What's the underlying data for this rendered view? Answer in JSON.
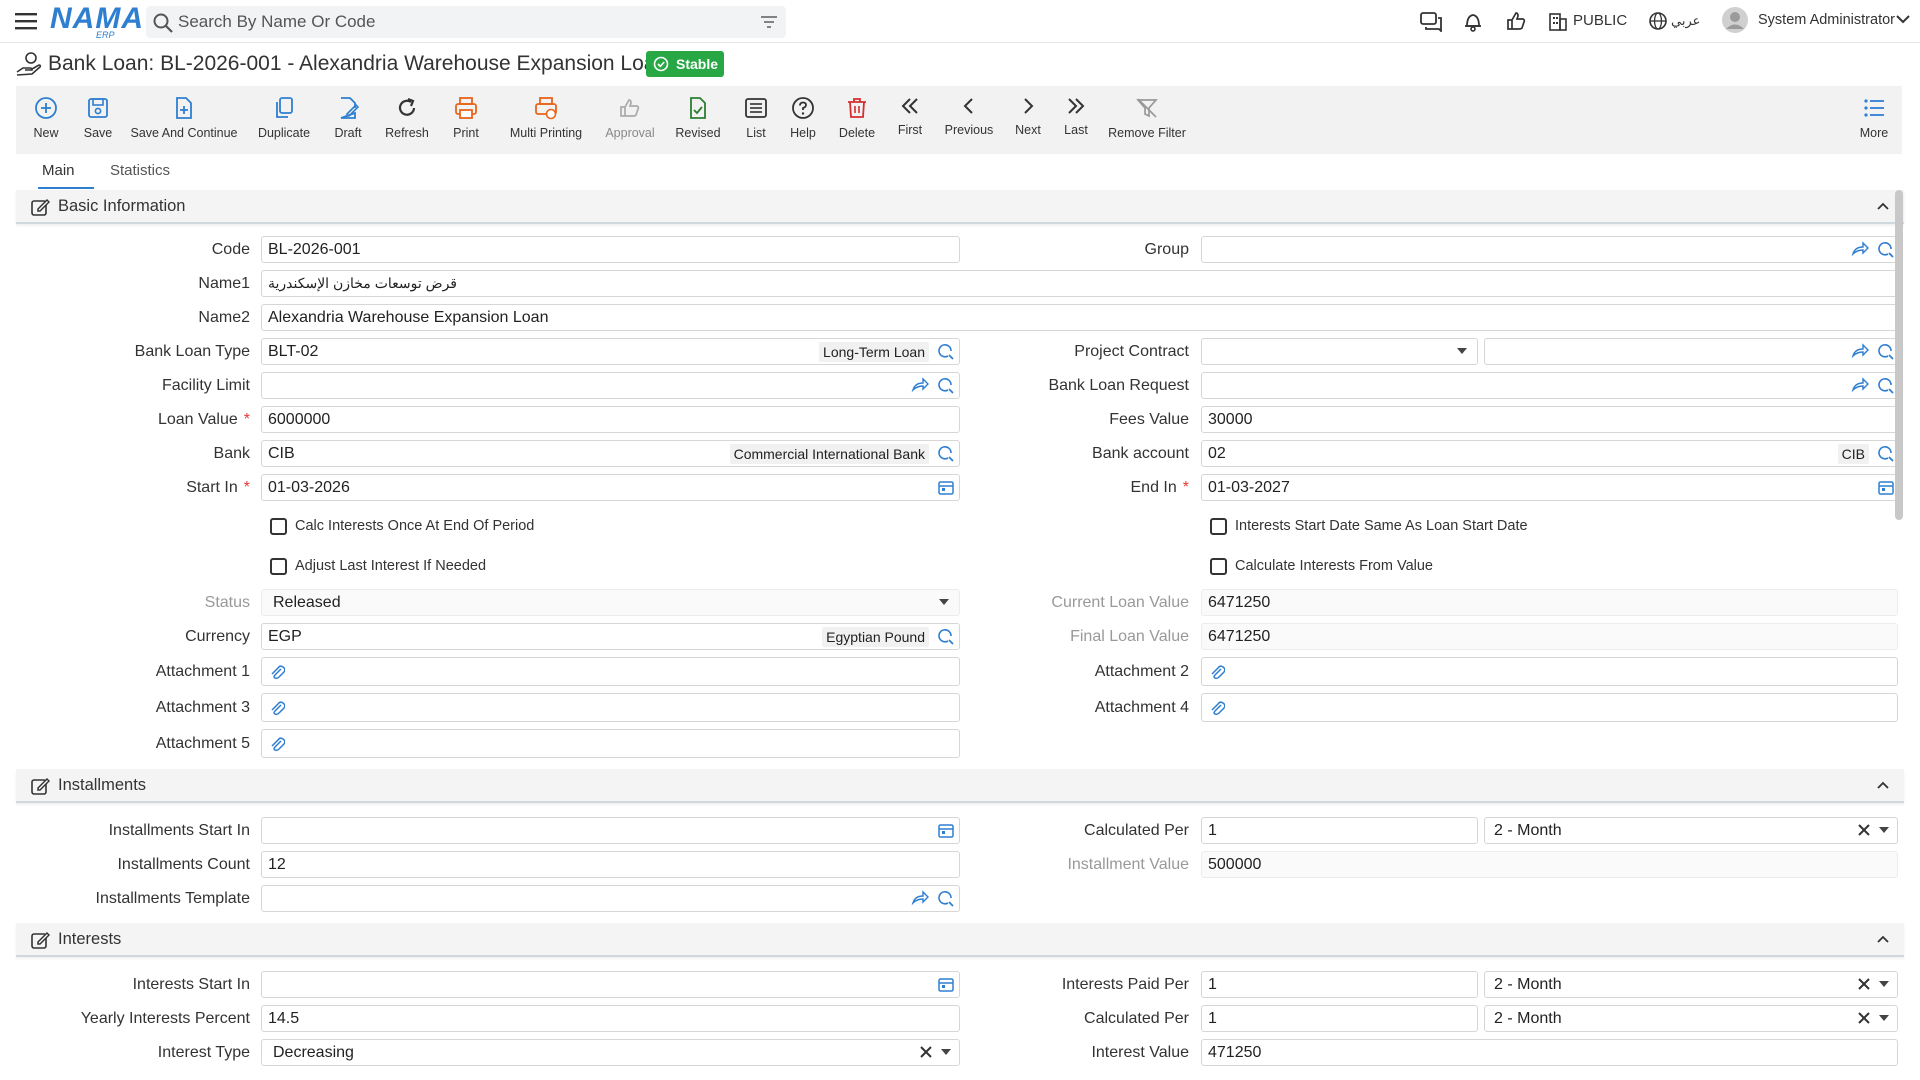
{
  "app": {
    "logo": "NAMA",
    "logo_sub": "ERP"
  },
  "search": {
    "placeholder": "Search By Name Or Code"
  },
  "topbar": {
    "branch": "PUBLIC",
    "language": "عربي",
    "user": "System Administrator"
  },
  "record": {
    "title": "Bank Loan: BL-2026-001 - Alexandria Warehouse Expansion Loan",
    "status": "Stable"
  },
  "toolbar": {
    "new": "New",
    "save": "Save",
    "save_continue": "Save And Continue",
    "duplicate": "Duplicate",
    "draft": "Draft",
    "refresh": "Refresh",
    "print": "Print",
    "multi_printing": "Multi Printing",
    "approval": "Approval",
    "revised": "Revised",
    "list": "List",
    "help": "Help",
    "delete": "Delete",
    "first": "First",
    "previous": "Previous",
    "next": "Next",
    "last": "Last",
    "remove_filter": "Remove Filter",
    "more": "More"
  },
  "tabs": {
    "main": "Main",
    "statistics": "Statistics"
  },
  "basic": {
    "title": "Basic Information",
    "code_label": "Code",
    "code": "BL-2026-001",
    "group_label": "Group",
    "group": "",
    "name1_label": "Name1",
    "name1": "قرض توسعات مخازن الإسكندرية",
    "name2_label": "Name2",
    "name2": "Alexandria Warehouse Expansion Loan",
    "loan_type_label": "Bank Loan Type",
    "loan_type_code": "BLT-02",
    "loan_type_name": "Long-Term Loan",
    "project_contract_label": "Project Contract",
    "facility_limit_label": "Facility Limit",
    "loan_request_label": "Bank Loan Request",
    "loan_value_label": "Loan Value",
    "loan_value": "6000000",
    "fees_value_label": "Fees Value",
    "fees_value": "30000",
    "bank_label": "Bank",
    "bank_code": "CIB",
    "bank_name": "Commercial International Bank",
    "bank_account_label": "Bank account",
    "bank_account": "02",
    "bank_account_tag": "CIB",
    "start_in_label": "Start In",
    "start_in": "01-03-2026",
    "end_in_label": "End In",
    "end_in": "01-03-2027",
    "calc_once_label": "Calc Interests Once At End Of Period",
    "interests_start_same_label": "Interests Start Date Same As Loan Start Date",
    "adjust_last_label": "Adjust Last Interest If Needed",
    "calc_from_value_label": "Calculate Interests From Value",
    "status_label": "Status",
    "status": "Released",
    "current_loan_label": "Current Loan Value",
    "current_loan": "6471250",
    "currency_label": "Currency",
    "currency_code": "EGP",
    "currency_name": "Egyptian Pound",
    "final_loan_label": "Final Loan Value",
    "final_loan": "6471250",
    "att1_label": "Attachment 1",
    "att2_label": "Attachment 2",
    "att3_label": "Attachment 3",
    "att4_label": "Attachment 4",
    "att5_label": "Attachment 5"
  },
  "installments": {
    "title": "Installments",
    "start_in_label": "Installments Start In",
    "calculated_per_label": "Calculated Per",
    "calculated_per": "1",
    "calculated_per_unit": "2 - Month",
    "count_label": "Installments Count",
    "count": "12",
    "value_label": "Installment Value",
    "value": "500000",
    "template_label": "Installments Template"
  },
  "interests": {
    "title": "Interests",
    "start_in_label": "Interests Start In",
    "paid_per_label": "Interests Paid Per",
    "paid_per": "1",
    "paid_per_unit": "2 - Month",
    "yearly_percent_label": "Yearly Interests Percent",
    "yearly_percent": "14.5",
    "calculated_per_label": "Calculated Per",
    "calculated_per": "1",
    "calculated_per_unit": "2 - Month",
    "type_label": "Interest Type",
    "type": "Decreasing",
    "value_label": "Interest Value",
    "value": "471250"
  },
  "colors": {
    "brand": "#2f7fd0",
    "stable": "#28a745",
    "required": "#e53935",
    "print_orange": "#e8641b",
    "delete_red": "#d32f2f",
    "revised_green": "#2e7d32"
  }
}
